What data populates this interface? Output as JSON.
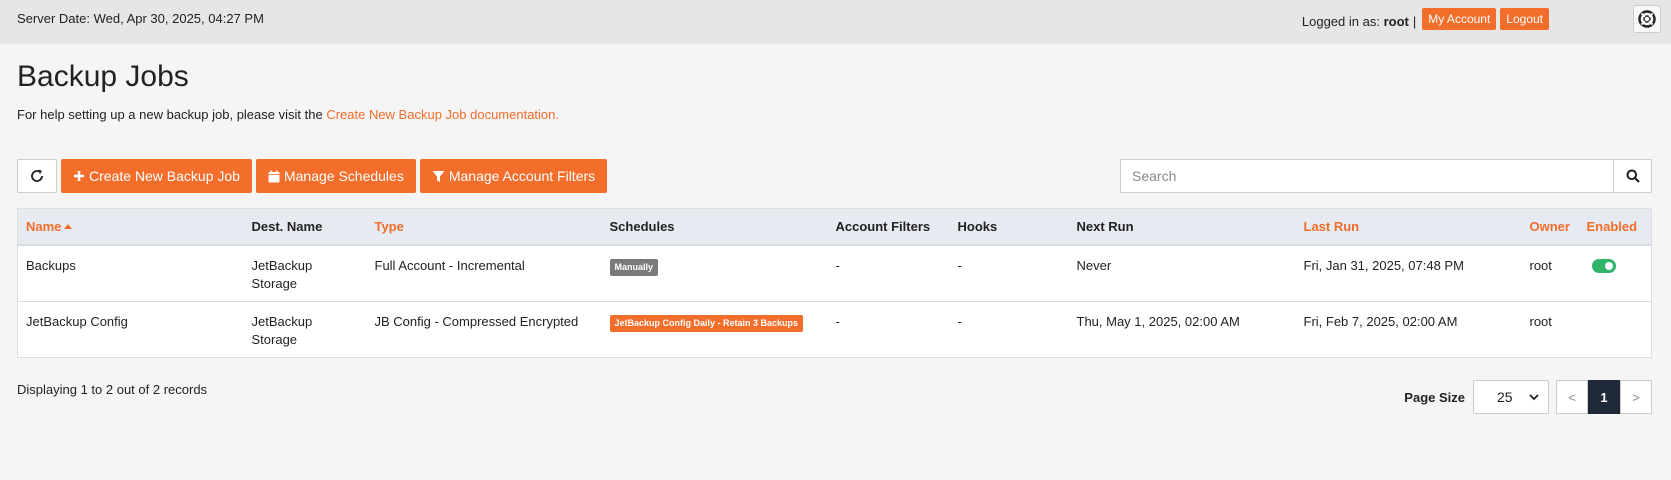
{
  "header": {
    "server_date": "Server Date: Wed, Apr 30, 2025, 04:27 PM",
    "logged_in_prefix": "Logged in as:",
    "username": "root",
    "separator": "|",
    "my_account_label": "My Account",
    "logout_label": "Logout",
    "help_icon": "lifebuoy-icon"
  },
  "page": {
    "title": "Backup Jobs",
    "help_text": "For help setting up a new backup job, please visit the",
    "help_link": "Create New Backup Job documentation."
  },
  "toolbar": {
    "refresh_icon": "refresh-icon",
    "create_label": "Create New Backup Job",
    "schedules_label": "Manage Schedules",
    "filters_label": "Manage Account Filters"
  },
  "search": {
    "placeholder": "Search",
    "value": ""
  },
  "table": {
    "columns": {
      "name": "Name",
      "dest_name": "Dest. Name",
      "type": "Type",
      "schedules": "Schedules",
      "account_filters": "Account Filters",
      "hooks": "Hooks",
      "next_run": "Next Run",
      "last_run": "Last Run",
      "owner": "Owner",
      "enabled": "Enabled"
    },
    "rows": [
      {
        "name": "Backups",
        "dest_line1": "JetBackup",
        "dest_line2": "Storage",
        "type": "Full Account - Incremental",
        "schedule": "Manually",
        "account_filters": "-",
        "hooks": "-",
        "next_run": "Never",
        "last_run": "Fri, Jan 31, 2025, 07:48 PM",
        "owner": "root",
        "enabled": true
      },
      {
        "name": "JetBackup Config",
        "dest_line1": "JetBackup",
        "dest_line2": "Storage",
        "type": "JB Config - Compressed Encrypted",
        "schedule": "JetBackup Config Daily - Retain 3 Backups",
        "account_filters": "-",
        "hooks": "-",
        "next_run": "Thu, May 1, 2025, 02:00 AM",
        "last_run": "Fri, Feb 7, 2025, 02:00 AM",
        "owner": "root",
        "enabled": false
      }
    ]
  },
  "footer": {
    "records_text": "Displaying 1 to 2 out of 2 records",
    "page_size_label": "Page Size",
    "page_size_value": "25",
    "prev": "<",
    "current_page": "1",
    "next": ">"
  },
  "colors": {
    "accent": "#f36d2b",
    "enabled": "#2eb567",
    "active_page": "#1f2a38"
  }
}
